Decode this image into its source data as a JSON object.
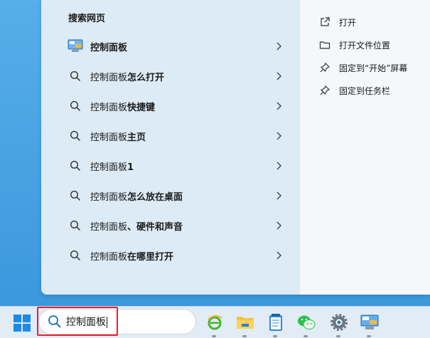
{
  "search_panel": {
    "section_title": "搜索网页",
    "results": [
      {
        "prefix": "控制面板",
        "suffix": "",
        "icon": "control-panel-icon"
      },
      {
        "prefix": "控制面板",
        "suffix": "怎么打开",
        "icon": "search-icon"
      },
      {
        "prefix": "控制面板",
        "suffix": "快捷键",
        "icon": "search-icon"
      },
      {
        "prefix": "控制面板",
        "suffix": "主页",
        "icon": "search-icon"
      },
      {
        "prefix": "控制面板",
        "suffix": "1",
        "icon": "search-icon"
      },
      {
        "prefix": "控制面板",
        "suffix": "怎么放在桌面",
        "icon": "search-icon"
      },
      {
        "prefix": "控制面板",
        "suffix": "、硬件和声音",
        "icon": "search-icon"
      },
      {
        "prefix": "控制面板",
        "suffix": "在哪里打开",
        "icon": "search-icon"
      }
    ],
    "actions": [
      {
        "label": "打开",
        "icon": "open-external-icon"
      },
      {
        "label": "打开文件位置",
        "icon": "folder-icon"
      },
      {
        "label": "固定到“开始”屏幕",
        "icon": "pin-icon"
      },
      {
        "label": "固定到任务栏",
        "icon": "pin-icon"
      }
    ]
  },
  "taskbar": {
    "search_value": "控制面板",
    "apps": [
      {
        "name": "ie-browser",
        "icon": "ie-icon"
      },
      {
        "name": "file-explorer",
        "icon": "folder-icon"
      },
      {
        "name": "notepad",
        "icon": "notepad-icon"
      },
      {
        "name": "wechat",
        "icon": "wechat-icon"
      },
      {
        "name": "settings",
        "icon": "gear-icon"
      },
      {
        "name": "control-panel",
        "icon": "control-panel-icon"
      }
    ]
  },
  "colors": {
    "accent": "#0a66c2",
    "highlight_border": "#e8202a",
    "desktop": "#3e9fe0"
  }
}
